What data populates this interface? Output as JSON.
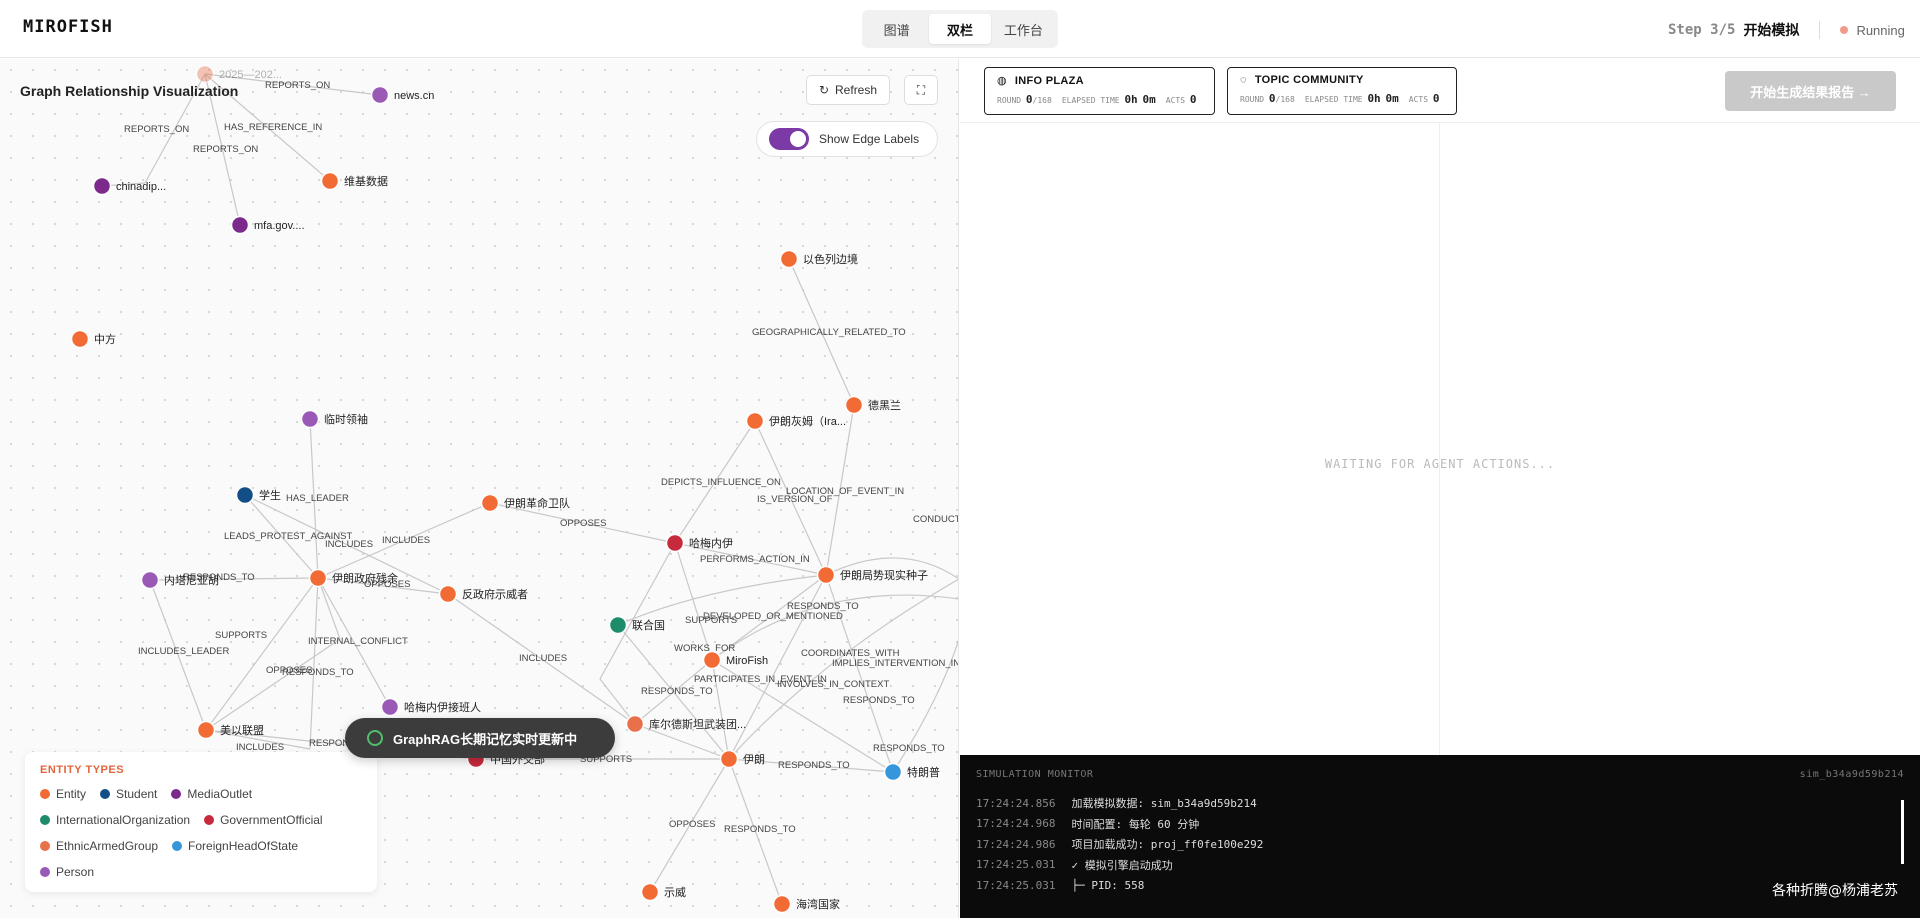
{
  "header": {
    "brand": "MIROFISH",
    "tabs": [
      {
        "label": "图谱"
      },
      {
        "label": "双栏"
      },
      {
        "label": "工作台"
      }
    ],
    "step_num": "Step 3/5",
    "step_title": "开始模拟",
    "status": "Running"
  },
  "graph": {
    "title": "Graph Relationship Visualization",
    "refresh_label": "Refresh",
    "fullscreen_icon": "fullscreen-icon",
    "edge_label_toggle": "Show Edge Labels",
    "nodes": [
      {
        "label": "2025—202...",
        "type": "EthnicArmedGroup"
      },
      {
        "label": "news.cn",
        "type": "Person"
      },
      {
        "label": "chinadip...",
        "type": "MediaOutlet"
      },
      {
        "label": "维基数据",
        "type": "Entity"
      },
      {
        "label": "mfa.gov....",
        "type": "MediaOutlet"
      },
      {
        "label": "以色列边境",
        "type": "Entity"
      },
      {
        "label": "中方",
        "type": "Entity"
      },
      {
        "label": "德黑兰",
        "type": "Entity"
      },
      {
        "label": "伊朗灰姆（Ira...",
        "type": "Entity"
      },
      {
        "label": "临时领袖",
        "type": "Person"
      },
      {
        "label": "学生",
        "type": "Student"
      },
      {
        "label": "伊朗革命卫队",
        "type": "Entity"
      },
      {
        "label": "哈梅内伊",
        "type": "GovernmentOfficial"
      },
      {
        "label": "伊朗政府残余",
        "type": "Entity"
      },
      {
        "label": "伊朗局势现实种子",
        "type": "Entity"
      },
      {
        "label": "内塔尼亚胡",
        "type": "Person"
      },
      {
        "label": "反政府示威者",
        "type": "Entity"
      },
      {
        "label": "联合国",
        "type": "InternationalOrganization"
      },
      {
        "label": "MiroFish",
        "type": "Entity"
      },
      {
        "label": "哈梅内伊接班人",
        "type": "Person"
      },
      {
        "label": "库尔德斯坦武装团...",
        "type": "EthnicArmedGroup"
      },
      {
        "label": "美以联盟",
        "type": "Entity"
      },
      {
        "label": "中国外交部",
        "type": "GovernmentOfficial"
      },
      {
        "label": "伊朗",
        "type": "Entity"
      },
      {
        "label": "特朗普",
        "type": "ForeignHeadOfState"
      },
      {
        "label": "示威",
        "type": "Entity"
      },
      {
        "label": "海湾国家",
        "type": "Entity"
      }
    ],
    "edge_labels": [
      "REPORTS_ON",
      "REPORTS_ON",
      "HAS_REFERENCE_IN",
      "REPORTS_ON",
      "GEOGRAPHICALLY_RELATED_TO",
      "DEPICTS_INFLUENCE_ON",
      "IS_VERSION_OF",
      "LOCATION_OF_EVENT_IN",
      "HAS_LEADER",
      "LEADS_PROTEST_AGAINST",
      "INCLUDES",
      "INCLUDES",
      "OPPOSES",
      "PERFORMS_ACTION_IN",
      "RESPONDS_TO",
      "OPPOSES",
      "RESPONDS_TO",
      "SUPPORTS",
      "DEVELOPED_OR_MENTIONED",
      "SUPPORTS",
      "INCLUDES_LEADER",
      "INTERNAL_CONFLICT",
      "OPPOSES",
      "RESPONDS_TO",
      "INCLUDES",
      "WORKS_FOR",
      "COORDINATES_WITH",
      "IMPLIES_INTERVENTION_IN",
      "PARTICIPATES_IN_EVENT_IN",
      "INVOLVES_IN_CONTEXT",
      "RESPONDS_TO",
      "RESPONDS_TO",
      "RESPONDS_TO",
      "INCLUDES",
      "RESPONDS",
      "SUPPORTS",
      "RESPONDS_TO",
      "OPPOSES",
      "RESPONDS_TO",
      "CONDUCT"
    ],
    "legend": {
      "title": "ENTITY TYPES",
      "items": [
        {
          "label": "Entity",
          "color": "#f26b35"
        },
        {
          "label": "Student",
          "color": "#134f86"
        },
        {
          "label": "MediaOutlet",
          "color": "#7b2a8c"
        },
        {
          "label": "InternationalOrganization",
          "color": "#1c8c6a"
        },
        {
          "label": "GovernmentOfficial",
          "color": "#c72a3c"
        },
        {
          "label": "EthnicArmedGroup",
          "color": "#e8704a"
        },
        {
          "label": "ForeignHeadOfState",
          "color": "#3596db"
        },
        {
          "label": "Person",
          "color": "#9b59b6"
        }
      ]
    },
    "toast": "GraphRAG长期记忆实时更新中"
  },
  "right": {
    "info_plaza": {
      "title": "INFO PLAZA",
      "round_label": "ROUND",
      "round": "0",
      "round_total": "/168",
      "elapsed_label": "ELAPSED TIME",
      "elapsed_h": "0h",
      "elapsed_m": "0m",
      "acts_label": "ACTS",
      "acts": "0"
    },
    "topic_community": {
      "title": "TOPIC COMMUNITY",
      "round_label": "ROUND",
      "round": "0",
      "round_total": "/168",
      "elapsed_label": "ELAPSED TIME",
      "elapsed_h": "0h",
      "elapsed_m": "0m",
      "acts_label": "ACTS",
      "acts": "0"
    },
    "report_button": "开始生成结果报告 →",
    "waiting": "WAITING FOR AGENT ACTIONS...",
    "monitor": {
      "title": "SIMULATION MONITOR",
      "sim_id": "sim_b34a9d59b214",
      "logs": [
        {
          "ts": "17:24:24.856",
          "msg": "加载模拟数据: sim_b34a9d59b214"
        },
        {
          "ts": "17:24:24.968",
          "msg": "时间配置: 每轮 60 分钟"
        },
        {
          "ts": "17:24:24.986",
          "msg": "项目加载成功: proj_ff0fe100e292"
        },
        {
          "ts": "17:24:25.031",
          "msg": "✓ 模拟引擎启动成功"
        },
        {
          "ts": "17:24:25.031",
          "msg": "├─ PID: 558"
        }
      ]
    },
    "watermark": "各种折腾@杨浦老苏"
  }
}
